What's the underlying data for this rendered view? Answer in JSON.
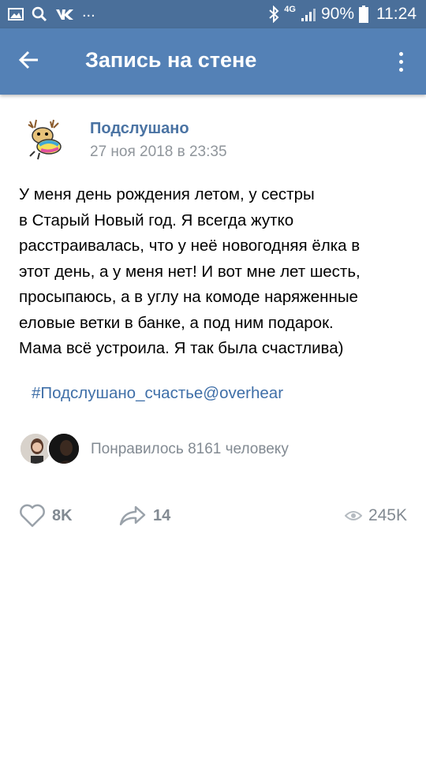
{
  "statusbar": {
    "left_icons": [
      "image-icon",
      "search-icon",
      "vk-icon"
    ],
    "more": "...",
    "network": "4G",
    "battery": "90%",
    "time": "11:24"
  },
  "appbar": {
    "title": "Запись на стене"
  },
  "post": {
    "group_name": "Подслушано",
    "date": "27 ноя 2018 в 23:35",
    "text_lines": [
      "У меня день рождения летом, у сестры",
      "в Старый Новый год. Я всегда жутко",
      "расстраивалась, что у неё новогодняя ёлка в",
      "этот день, а у меня нет! И вот мне лет шесть,",
      "просыпаюсь, а в углу на комоде наряженные",
      "еловые ветки в банке, а под ним подарок.",
      "Мама всё устроила. Я так была счастлива)"
    ],
    "hashtag": "#Подслушано_счастье@overhear",
    "liked_by": "Понравилось 8161 человеку"
  },
  "actions": {
    "likes": "8K",
    "shares": "14",
    "views": "245K"
  },
  "colors": {
    "statusbar": "#4a6f9a",
    "appbar": "#5481b6",
    "link": "#4a73a3",
    "muted": "#828a92"
  }
}
